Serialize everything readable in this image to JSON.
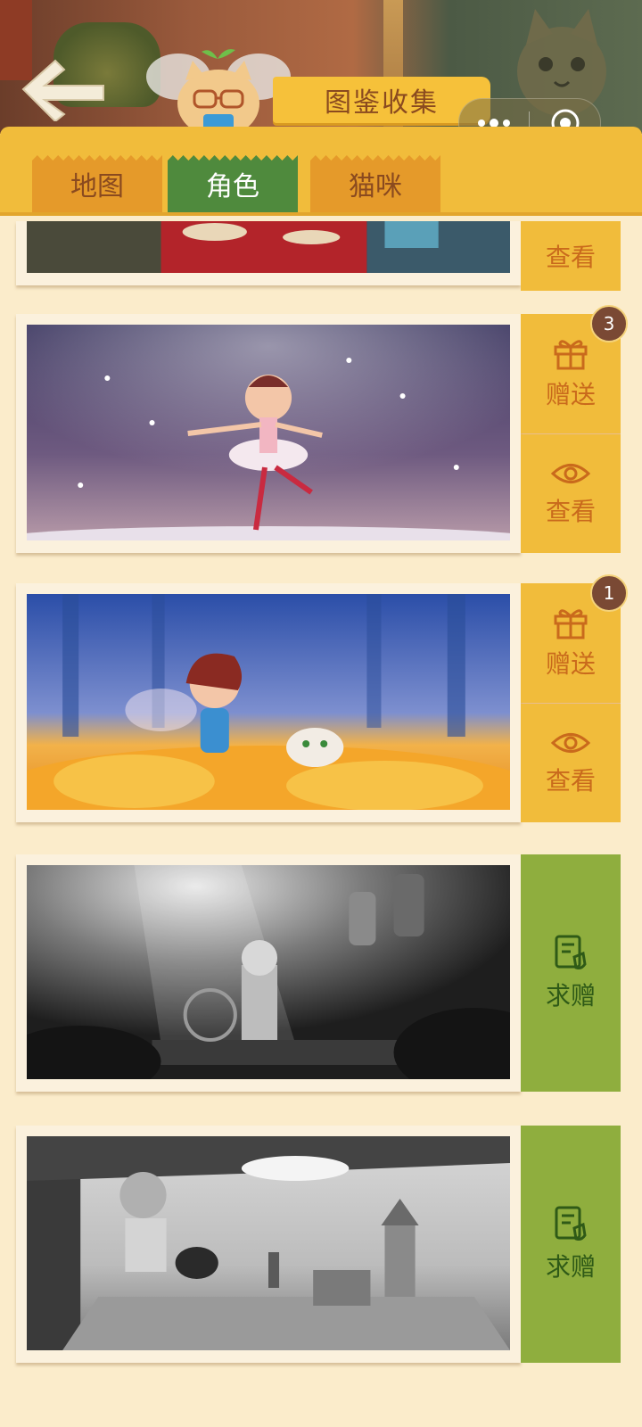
{
  "header": {
    "title": "图鉴收集",
    "back_icon": "back-arrow-icon",
    "more_icon": "more-dots-icon",
    "close_icon": "close-target-icon"
  },
  "tabs": [
    {
      "label": "地图",
      "active": false
    },
    {
      "label": "角色",
      "active": true
    },
    {
      "label": "猫咪",
      "active": false
    }
  ],
  "cards": [
    {
      "scene": "tea-party",
      "locked": false,
      "actions": [
        {
          "icon": "eye-icon",
          "label": "查看"
        }
      ]
    },
    {
      "scene": "ballerina-fairy",
      "locked": false,
      "badge": "3",
      "actions": [
        {
          "icon": "gift-icon",
          "label": "赠送"
        },
        {
          "icon": "eye-icon",
          "label": "查看"
        }
      ]
    },
    {
      "scene": "autumn-fairy-with-cat",
      "locked": false,
      "badge": "1",
      "actions": [
        {
          "icon": "gift-icon",
          "label": "赠送"
        },
        {
          "icon": "eye-icon",
          "label": "查看"
        }
      ]
    },
    {
      "scene": "stage-grayscale",
      "locked": true,
      "actions": [
        {
          "icon": "request-icon",
          "label": "求赠"
        }
      ]
    },
    {
      "scene": "picnic-grayscale",
      "locked": true,
      "actions": [
        {
          "icon": "request-icon",
          "label": "求赠"
        }
      ]
    }
  ],
  "colors": {
    "page_bg": "#fbeccb",
    "tab_bar": "#f1bc3b",
    "tab_active": "#4f8a3d",
    "tab_inactive": "#e59a2a",
    "action_orange": "#f1bc3b",
    "action_green": "#8fae3e",
    "badge": "#7a4934"
  }
}
